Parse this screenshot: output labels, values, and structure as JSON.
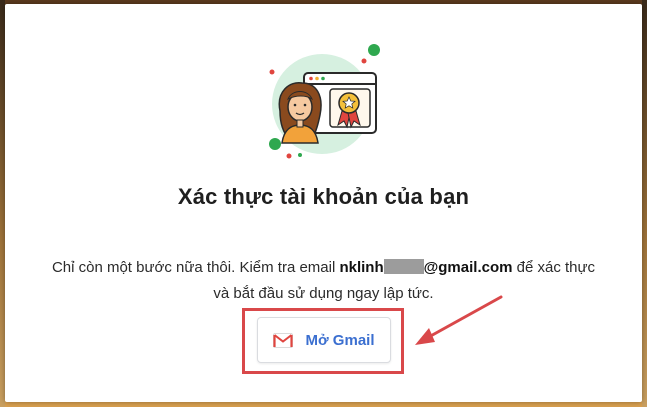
{
  "dialog": {
    "title": "Xác thực tài khoản của bạn",
    "message_part1": "Chỉ còn một bước nữa thôi. Kiểm tra email ",
    "email_prefix": "nklinh",
    "email_suffix": "@gmail.com",
    "message_part2": " để xác thực và bắt đầu sử dụng ngay lập tức.",
    "button_label": "Mở Gmail",
    "button_icon": "gmail-icon",
    "illustration": "verified-user-certificate-illustration"
  },
  "annotation": {
    "highlight_color": "#d9484a",
    "arrow_color": "#d9484a"
  },
  "colors": {
    "button_text": "#3b6fd0",
    "illustration_circle": "#d6f0e0",
    "dot_green": "#2fa84f",
    "dot_red": "#e0453f"
  }
}
